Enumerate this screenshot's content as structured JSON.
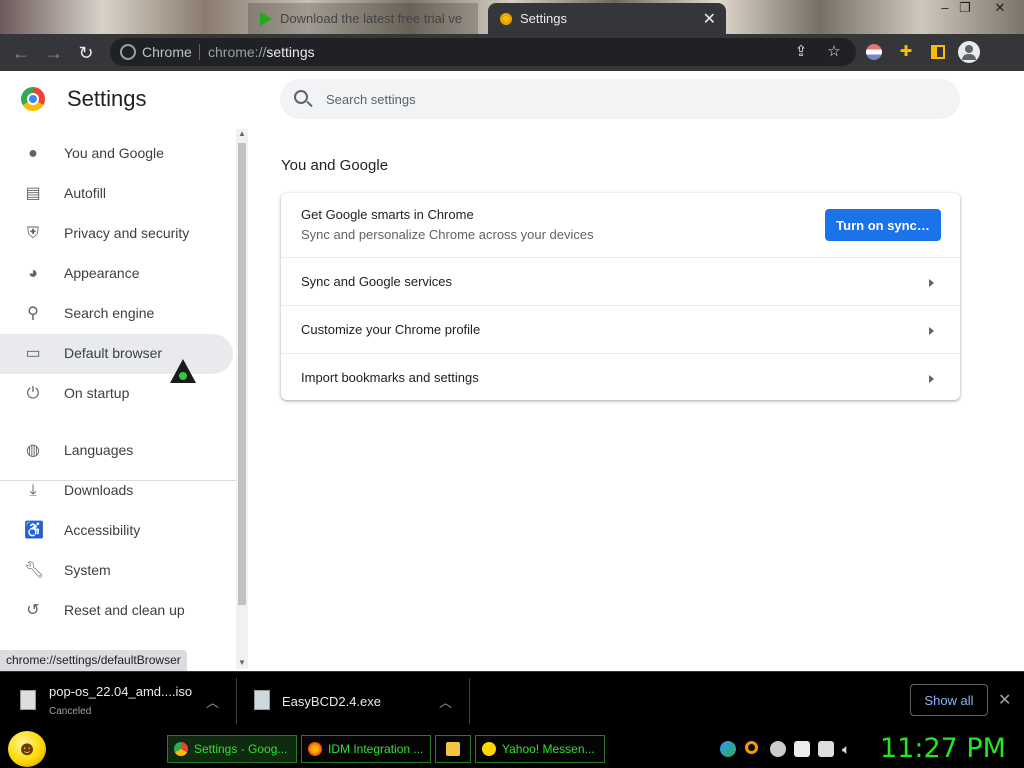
{
  "browser": {
    "tabs": [
      {
        "label": "Download the latest free trial ve",
        "active": false
      },
      {
        "label": "Settings",
        "active": true
      }
    ],
    "window_controls": [
      "–",
      "❐",
      "✕"
    ],
    "site_label": "Chrome",
    "url_prefix": "chrome://",
    "url_path": "settings"
  },
  "settings": {
    "title": "Settings",
    "search_placeholder": "Search settings",
    "sidebar_items": [
      {
        "label": "You and Google",
        "icon": "person-icon"
      },
      {
        "label": "Autofill",
        "icon": "clipboard-icon"
      },
      {
        "label": "Privacy and security",
        "icon": "shield-icon"
      },
      {
        "label": "Appearance",
        "icon": "palette-icon"
      },
      {
        "label": "Search engine",
        "icon": "search-icon"
      },
      {
        "label": "Default browser",
        "icon": "browser-window-icon"
      },
      {
        "label": "On startup",
        "icon": "power-icon"
      },
      {
        "label": "Languages",
        "icon": "globe-icon"
      },
      {
        "label": "Downloads",
        "icon": "download-icon"
      },
      {
        "label": "Accessibility",
        "icon": "accessibility-icon"
      },
      {
        "label": "System",
        "icon": "wrench-icon"
      },
      {
        "label": "Reset and clean up",
        "icon": "history-icon"
      }
    ],
    "section_title": "You and Google",
    "sync_card": {
      "title": "Get Google smarts in Chrome",
      "subtitle": "Sync and personalize Chrome across your devices",
      "button": "Turn on sync…"
    },
    "rows": [
      "Sync and Google services",
      "Customize your Chrome profile",
      "Import bookmarks and settings"
    ],
    "status_url": "chrome://settings/defaultBrowser"
  },
  "downloads": {
    "items": [
      {
        "name": "pop-os_22.04_amd....iso",
        "status": "Canceled"
      },
      {
        "name": "EasyBCD2.4.exe",
        "status": ""
      }
    ],
    "show_all": "Show all"
  },
  "taskbar": {
    "tasks": [
      {
        "label": "Settings - Goog...",
        "active": true
      },
      {
        "label": "IDM Integration ...",
        "active": false
      },
      {
        "label": "",
        "active": false
      },
      {
        "label": "Yahoo! Messen...",
        "active": false
      }
    ],
    "clock": "11:27 PM"
  },
  "colors": {
    "accent": "#1a73e8",
    "taskbar_text": "#22e822",
    "active_nav_bg": "#e8eaed"
  }
}
